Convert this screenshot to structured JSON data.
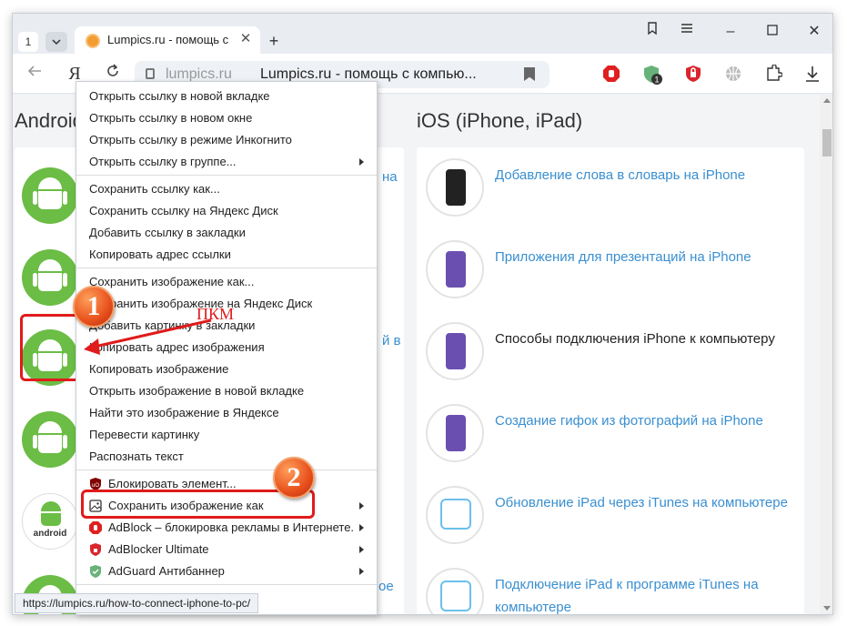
{
  "tabstrip": {
    "tab_count": "1",
    "tab_title": "Lumpics.ru - помощь с",
    "new_tab_symbol": "+"
  },
  "navbar": {
    "domain": "lumpics.ru",
    "page_title": "Lumpics.ru - помощь с компью...",
    "extension_badge": "1"
  },
  "page": {
    "android_title": "Android",
    "ios_title": "iOS (iPhone, iPad)",
    "android_word": "android",
    "left_link_fragments": [
      "на",
      "й в",
      "ое"
    ],
    "ios_items": [
      {
        "text": "Добавление слова в словарь на iPhone",
        "link": true
      },
      {
        "text": "Приложения для презентаций на iPhone",
        "link": true
      },
      {
        "text": "Способы подключения iPhone к компьютеру",
        "link": false
      },
      {
        "text": "Создание гифок из фотографий на iPhone",
        "link": true
      },
      {
        "text": "Обновление iPad через iTunes на компьютере",
        "link": true
      },
      {
        "text": "Подключение iPad к программе iTunes на компьютере",
        "link": true
      }
    ]
  },
  "context_menu": {
    "items": [
      {
        "label": "Открыть ссылку в новой вкладке"
      },
      {
        "label": "Открыть ссылку в новом окне"
      },
      {
        "label": "Открыть ссылку в режиме Инкогнито"
      },
      {
        "label": "Открыть ссылку в группе...",
        "submenu": true
      },
      {
        "label": "Сохранить ссылку как..."
      },
      {
        "label": "Сохранить ссылку на Яндекс Диск"
      },
      {
        "label": "Добавить ссылку в закладки"
      },
      {
        "label": "Копировать адрес ссылки"
      },
      {
        "label": "Сохранить изображение как..."
      },
      {
        "label": "Сохранить изображение на Яндекс Диск"
      },
      {
        "label": "Добавить картинку в закладки"
      },
      {
        "label": "Копировать адрес изображения"
      },
      {
        "label": "Копировать изображение"
      },
      {
        "label": "Открыть изображение в новой вкладке"
      },
      {
        "label": "Найти это изображение в Яндексе"
      },
      {
        "label": "Перевести картинку"
      },
      {
        "label": "Распознать текст"
      },
      {
        "label": "Блокировать элемент...",
        "icon": "ublock-icon"
      },
      {
        "label": "Сохранить изображение как",
        "icon": "image-icon",
        "submenu": true
      },
      {
        "label": "AdBlock – блокировка рекламы в Интернете.",
        "icon": "adblock-icon",
        "submenu": true
      },
      {
        "label": "AdBlocker Ultimate",
        "icon": "adblocker-ultimate-icon",
        "submenu": true
      },
      {
        "label": "AdGuard Антибаннер",
        "icon": "adguard-icon",
        "submenu": true
      }
    ]
  },
  "annotations": {
    "badge1": "1",
    "badge2": "2",
    "pkm_label": "ПКМ",
    "highlight_color": "#e01b1b"
  },
  "status_bar": {
    "url": "https://lumpics.ru/how-to-connect-iphone-to-pc/"
  },
  "colors": {
    "link": "#3a8fd0",
    "android_green": "#6bbd45",
    "ios_purple": "#6b4fb0"
  }
}
